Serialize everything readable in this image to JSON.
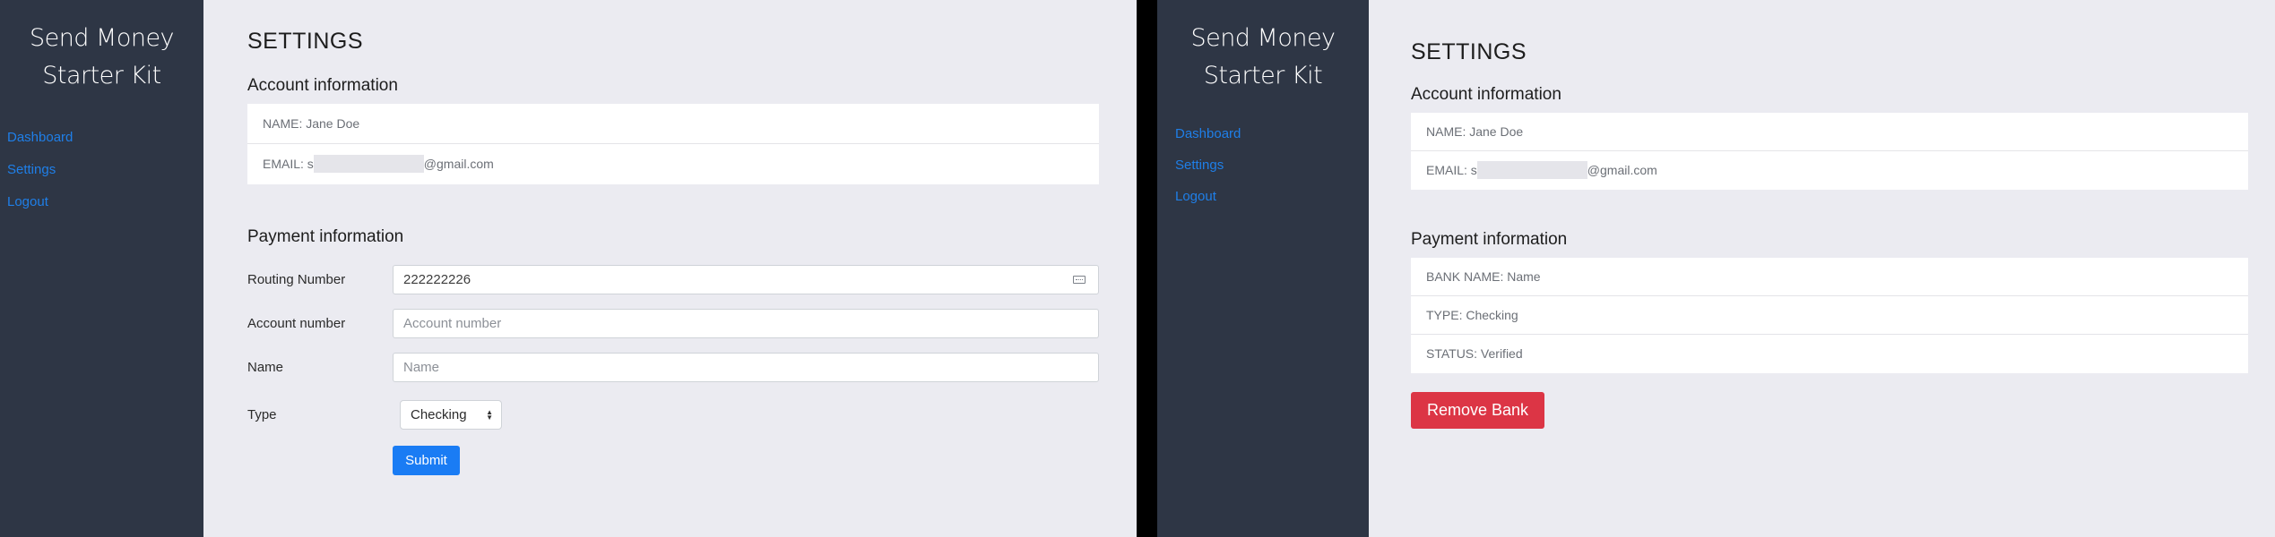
{
  "brand": {
    "line1": "Send Money",
    "line2": "Starter Kit"
  },
  "nav": [
    {
      "label": "Dashboard"
    },
    {
      "label": "Settings"
    },
    {
      "label": "Logout"
    }
  ],
  "page_title": "SETTINGS",
  "account": {
    "title": "Account information",
    "name": "NAME: Jane Doe",
    "email_prefix": "EMAIL: s",
    "email_suffix": "@gmail.com"
  },
  "payment": {
    "title": "Payment information",
    "routing_label": "Routing Number",
    "routing_value": "222222226",
    "account_label": "Account number",
    "account_placeholder": "Account number",
    "name_label": "Name",
    "name_placeholder": "Name",
    "type_label": "Type",
    "type_selected": "Checking",
    "submit_label": "Submit"
  },
  "bank": {
    "bank_name": "BANK NAME: Name",
    "type": "TYPE: Checking",
    "status": "STATUS: Verified",
    "remove_label": "Remove Bank"
  },
  "colors": {
    "sidebar_bg": "#2e3645",
    "page_bg": "#ebebf1",
    "link": "#1f7fe8",
    "primary": "#1a7cf4",
    "danger": "#dc3545"
  }
}
